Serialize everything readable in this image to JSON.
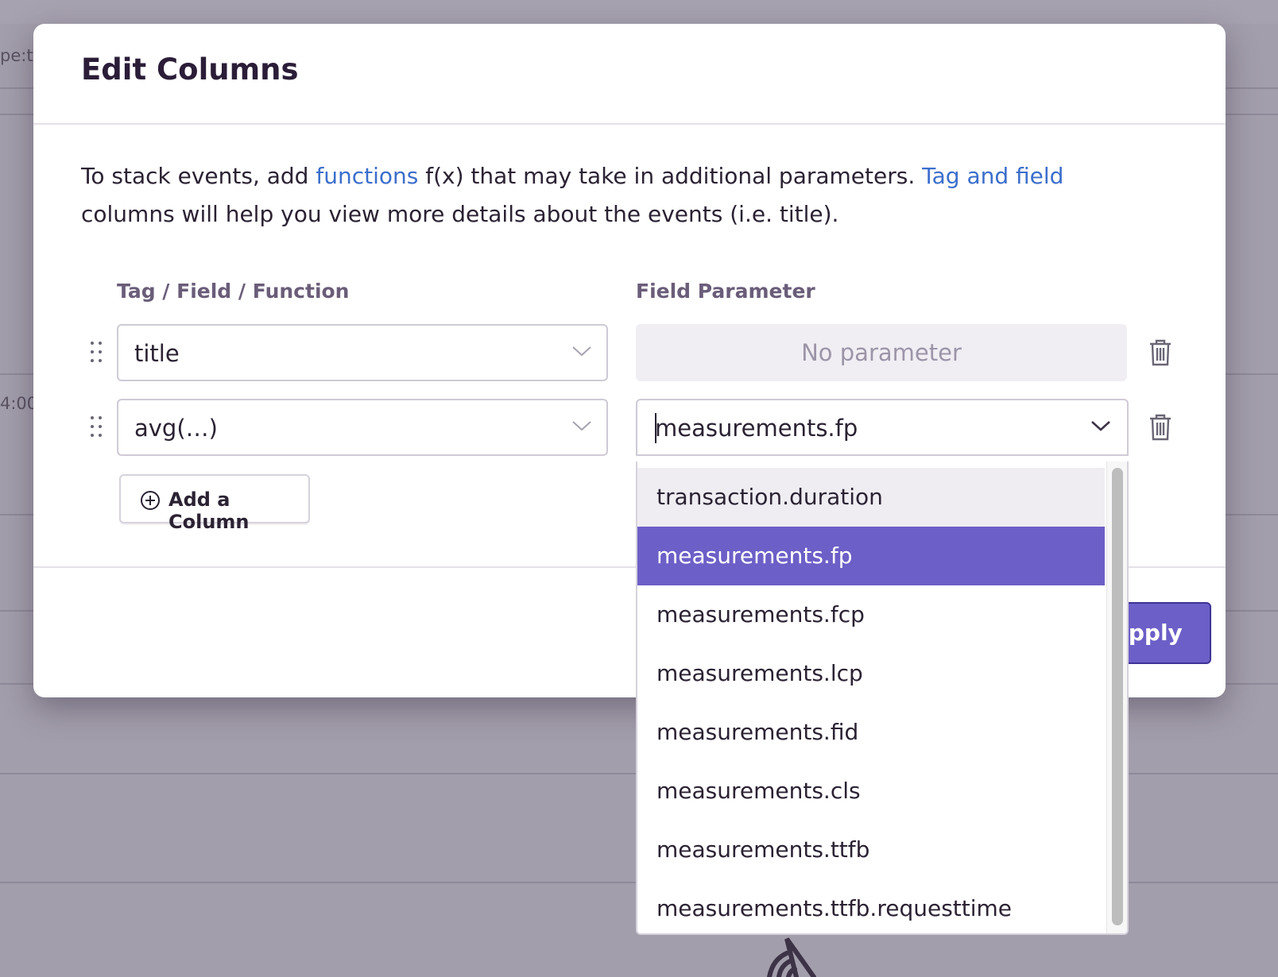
{
  "background": {
    "fragment_left_top": "pe:t",
    "fragment_time": "4:00"
  },
  "modal": {
    "title": "Edit Columns",
    "intro": {
      "before_link1": "To stack events, add ",
      "link1": "functions",
      "between": " f(x) that may take in additional parameters. ",
      "link2": "Tag and field",
      "after": " columns will help you view more details about the events (i.e. title)."
    },
    "headers": {
      "tag_field_function": "Tag / Field / Function",
      "field_parameter": "Field Parameter"
    },
    "rows": [
      {
        "field": "title",
        "parameter": "No parameter"
      },
      {
        "field": "avg(…)",
        "parameter": "measurements.fp"
      }
    ],
    "add_column_label": "Add a Column",
    "apply_label": "Apply"
  },
  "dropdown": {
    "options": [
      "transaction.duration",
      "measurements.fp",
      "measurements.fcp",
      "measurements.lcp",
      "measurements.fid",
      "measurements.cls",
      "measurements.ttfb",
      "measurements.ttfb.requesttime"
    ],
    "hovered_option": "transaction.duration",
    "selected_option": "measurements.fp"
  },
  "colors": {
    "accent": "#6c5fc7",
    "link": "#3b6ecc",
    "overlay": "#a39eac"
  }
}
